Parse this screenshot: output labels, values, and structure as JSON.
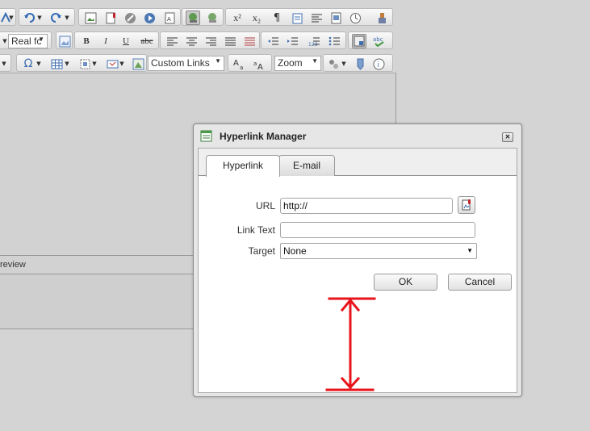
{
  "toolbar": {
    "font_name": "Real fc",
    "custom_links": "Custom Links",
    "zoom": "Zoom",
    "bold": "B",
    "italic": "I",
    "underline": "U",
    "strike": "abc",
    "superscript": "x²",
    "subscript": "x₂",
    "paragraph": "¶",
    "omega": "Ω"
  },
  "editor": {
    "mode_label": "review"
  },
  "dialog": {
    "title": "Hyperlink Manager",
    "tabs": [
      {
        "label": "Hyperlink",
        "active": true
      },
      {
        "label": "E-mail",
        "active": false
      }
    ],
    "url_label": "URL",
    "url_value": "http://",
    "link_text_label": "Link Text",
    "link_text_value": "",
    "target_label": "Target",
    "target_value": "None",
    "ok_label": "OK",
    "cancel_label": "Cancel"
  },
  "annotation": {
    "color": "#e8141b"
  }
}
